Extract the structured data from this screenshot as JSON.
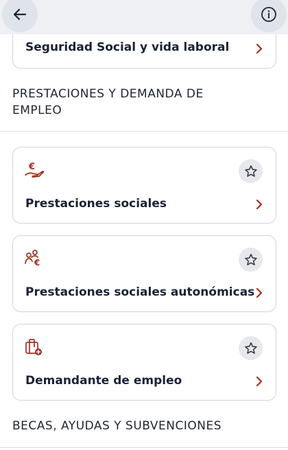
{
  "topbar": {
    "back_icon": "arrow-left-icon",
    "info_icon": "info-icon"
  },
  "colors": {
    "accent": "#a1301f",
    "topbar_bg": "#eef0f4",
    "card_border": "#cfd4dc",
    "fav_bg": "#e6e8ec"
  },
  "cards": [
    {
      "title": "Seguridad Social y vida laboral"
    },
    {
      "title": "Prestaciones sociales",
      "icon": "euro-hand-icon"
    },
    {
      "title": "Prestaciones sociales autonómicas",
      "icon": "people-euro-icon"
    },
    {
      "title": "Demandante de empleo",
      "icon": "briefcase-plus-icon"
    }
  ],
  "sections": [
    {
      "title": "PRESTACIONES Y DEMANDA DE EMPLEO"
    },
    {
      "title": "BECAS, AYUDAS Y SUBVENCIONES"
    }
  ]
}
